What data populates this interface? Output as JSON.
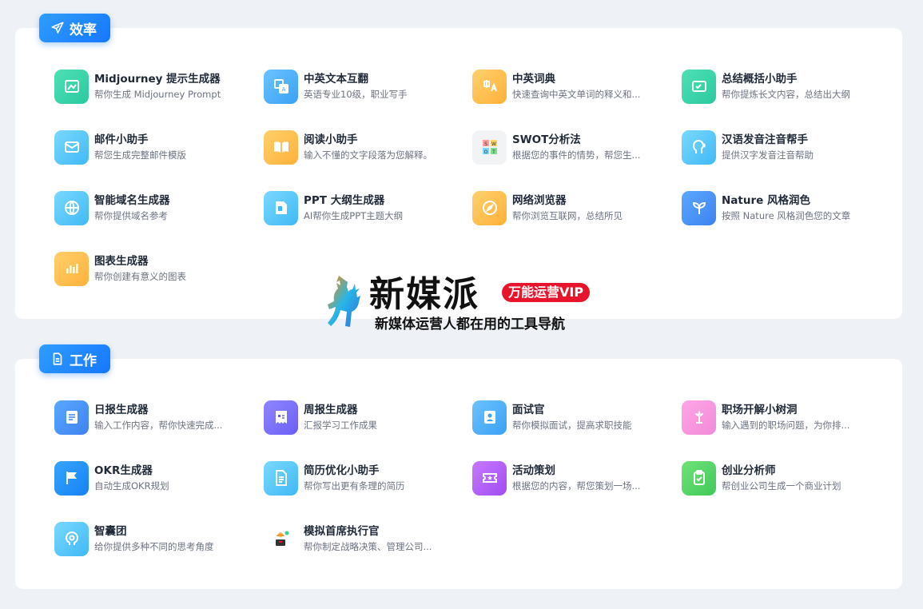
{
  "sections": {
    "efficiency": {
      "label": "效率"
    },
    "work": {
      "label": "工作"
    }
  },
  "efficiency_tools": [
    {
      "title": "Midjourney 提示生成器",
      "desc": "帮你生成 Midjourney Prompt",
      "icon": "paint-icon"
    },
    {
      "title": "中英文本互翻",
      "desc": "英语专业10级，职业写手",
      "icon": "translate-icon"
    },
    {
      "title": "中英词典",
      "desc": "快速查询中英文单词的释义和...",
      "icon": "dictionary-icon"
    },
    {
      "title": "总结概括小助手",
      "desc": "帮你提炼长文内容，总结出大纲",
      "icon": "summary-icon"
    },
    {
      "title": "邮件小助手",
      "desc": "帮您生成完整邮件模版",
      "icon": "mail-icon"
    },
    {
      "title": "阅读小助手",
      "desc": "输入不懂的文字段落为您解释。",
      "icon": "book-icon"
    },
    {
      "title": "SWOT分析法",
      "desc": "根据您的事件的情势，帮您生...",
      "icon": "swot-icon"
    },
    {
      "title": "汉语发音注音帮手",
      "desc": "提供汉字发音注音帮助",
      "icon": "speech-icon"
    },
    {
      "title": "智能域名生成器",
      "desc": "帮你提供域名参考",
      "icon": "globe-icon"
    },
    {
      "title": "PPT 大纲生成器",
      "desc": "AI帮你生成PPT主题大纲",
      "icon": "ppt-icon"
    },
    {
      "title": "网络浏览器",
      "desc": "帮你浏览互联网，总结所见",
      "icon": "compass-icon"
    },
    {
      "title": "Nature 风格润色",
      "desc": "按照 Nature 风格润色您的文章",
      "icon": "sprout-icon"
    },
    {
      "title": "图表生成器",
      "desc": "帮你创建有意义的图表",
      "icon": "bar-chart-icon"
    }
  ],
  "work_tools": [
    {
      "title": "日报生成器",
      "desc": "输入工作内容，帮你快速完成...",
      "icon": "daily-report-icon"
    },
    {
      "title": "周报生成器",
      "desc": "汇报学习工作成果",
      "icon": "weekly-report-icon"
    },
    {
      "title": "面试官",
      "desc": "帮你模拟面试，提高求职技能",
      "icon": "interview-icon"
    },
    {
      "title": "职场开解小树洞",
      "desc": "输入遇到的职场问题，为你排...",
      "icon": "flower-icon"
    },
    {
      "title": "OKR生成器",
      "desc": "自动生成OKR规划",
      "icon": "flag-icon"
    },
    {
      "title": "简历优化小助手",
      "desc": "帮你写出更有条理的简历",
      "icon": "resume-icon"
    },
    {
      "title": "活动策划",
      "desc": "根据您的内容，帮您策划一场...",
      "icon": "ticket-icon"
    },
    {
      "title": "创业分析师",
      "desc": "帮创业公司生成一个商业计划",
      "icon": "clipboard-icon"
    },
    {
      "title": "智囊团",
      "desc": "给你提供多种不同的思考角度",
      "icon": "brain-icon"
    },
    {
      "title": "模拟首席执行官",
      "desc": "帮你制定战略决策、管理公司...",
      "icon": "ceo-icon"
    }
  ],
  "watermark": {
    "brand": "新媒派",
    "badge": "万能运营VIP",
    "slogan": "新媒体运营人都在用的工具导航"
  }
}
